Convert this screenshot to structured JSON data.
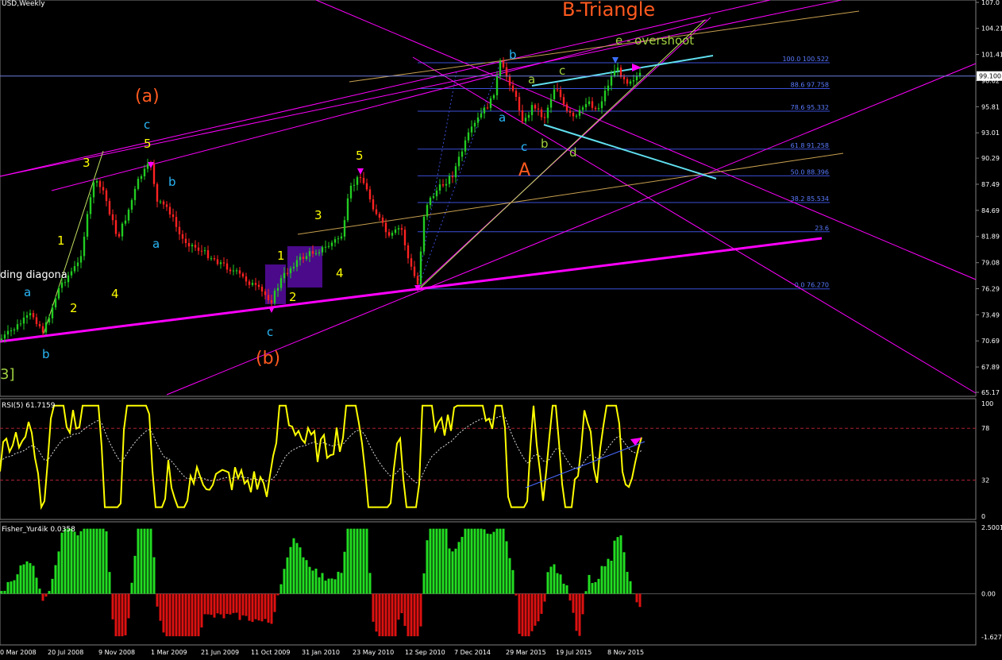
{
  "window": {
    "symbol_title": "USD,Weekly"
  },
  "colors": {
    "background": "#000000",
    "grid_border": "#7f7f7f",
    "bull_candle": "#22cc22",
    "bear_candle": "#ff2222",
    "magenta": "#ff00ff",
    "fib": "#3b4fd8",
    "fib_label": "#5a7bff",
    "orange": "#ff5a1f",
    "yellow": "#ffff00",
    "cyan": "#29b6f6",
    "olive": "#a0d040",
    "tan": "#c8a050",
    "rsi": "#ffff00",
    "fisher_pos": "#22dd22",
    "fisher_neg": "#dd1111",
    "light_cyan": "#60e0f0",
    "purple_box": "#4a0a8a"
  },
  "main_panel": {
    "price_axis_labels": [
      "107.0",
      "104.21",
      "101.41",
      "98.62",
      "95.81",
      "93.01",
      "90.29",
      "87.49",
      "84.69",
      "81.89",
      "79.08",
      "76.29",
      "73.49",
      "70.69",
      "67.89",
      "65.17"
    ],
    "current_price_label": "99.100",
    "fib_levels": [
      {
        "label": "100.0 100.522",
        "price": 100.52
      },
      {
        "label": "88.6 97.758",
        "price": 97.76
      },
      {
        "label": "78.6 95.332",
        "price": 95.33
      },
      {
        "label": "61.8 91.258",
        "price": 91.26
      },
      {
        "label": "50.0 88.396",
        "price": 88.4
      },
      {
        "label": "38.2 85.534",
        "price": 85.53
      },
      {
        "label": "23.6",
        "price": 82.4
      },
      {
        "label": "0.0 76.270",
        "price": 76.27
      }
    ],
    "annotations": [
      {
        "id": "title",
        "text": "B-Triangle",
        "color": "orange"
      },
      {
        "id": "overshoot",
        "text": "e - overshoot",
        "color": "olive"
      },
      {
        "id": "leading",
        "text": "ding diagona",
        "color": "white"
      },
      {
        "id": "bracket",
        "text": "3]",
        "color": "olive"
      },
      {
        "id": "w_a_big",
        "text": "(a)",
        "color": "orange"
      },
      {
        "id": "w_b_big",
        "text": "(b)",
        "color": "orange"
      },
      {
        "id": "w_A",
        "text": "A",
        "color": "orange"
      },
      {
        "id": "c1",
        "text": "c",
        "color": "cyan"
      },
      {
        "id": "y5a",
        "text": "5",
        "color": "yellow"
      },
      {
        "id": "y3a",
        "text": "3",
        "color": "yellow"
      },
      {
        "id": "y1a",
        "text": "1",
        "color": "yellow"
      },
      {
        "id": "y2a",
        "text": "2",
        "color": "yellow"
      },
      {
        "id": "y4a",
        "text": "4",
        "color": "yellow"
      },
      {
        "id": "ca",
        "text": "a",
        "color": "cyan"
      },
      {
        "id": "cb1",
        "text": "b",
        "color": "cyan"
      },
      {
        "id": "cb2",
        "text": "b",
        "color": "cyan"
      },
      {
        "id": "ca2",
        "text": "a",
        "color": "cyan"
      },
      {
        "id": "cc2",
        "text": "c",
        "color": "cyan"
      },
      {
        "id": "y1b",
        "text": "1",
        "color": "yellow"
      },
      {
        "id": "y2b",
        "text": "2",
        "color": "yellow"
      },
      {
        "id": "y3b",
        "text": "3",
        "color": "yellow"
      },
      {
        "id": "y4b",
        "text": "4",
        "color": "yellow"
      },
      {
        "id": "y5b",
        "text": "5",
        "color": "yellow"
      },
      {
        "id": "cb3",
        "text": "b",
        "color": "cyan"
      },
      {
        "id": "ca3",
        "text": "a",
        "color": "cyan"
      },
      {
        "id": "cc3",
        "text": "c",
        "color": "cyan"
      },
      {
        "id": "oa",
        "text": "a",
        "color": "olive"
      },
      {
        "id": "ob",
        "text": "b",
        "color": "olive"
      },
      {
        "id": "oc",
        "text": "c",
        "color": "olive"
      },
      {
        "id": "od",
        "text": "d",
        "color": "olive"
      }
    ]
  },
  "rsi_panel": {
    "title": "RSI(5) 61.7159",
    "axis_labels": [
      "100",
      "78",
      "32",
      "0"
    ],
    "levels": [
      78,
      32
    ]
  },
  "fisher_panel": {
    "title": "Fisher_Yur4ik 0.0358",
    "axis_labels": [
      "2.5001",
      "0.00",
      "-1.627"
    ]
  },
  "time_axis": {
    "labels": [
      "0 Mar 2008",
      "20 Jul 2008",
      "9 Nov 2008",
      "1 Mar 2009",
      "21 Jun 2009",
      "11 Oct 2009",
      "31 Jan 2010",
      "23 May 2010",
      "12 Sep 2010",
      "7 Dec 2014",
      "29 Mar 2015",
      "19 Jul 2015",
      "8 Nov 2015"
    ]
  },
  "chart_data": {
    "type": "candlestick",
    "title": "USD,Weekly",
    "ylim": [
      65.17,
      107.0
    ],
    "close_path": [
      {
        "x": "0 Mar 2008",
        "y": 72.5
      },
      {
        "x": "Jul 2008",
        "y": 72.0
      },
      {
        "x": "Nov 2008",
        "y": 87.5
      },
      {
        "x": "Nov 2008",
        "y": 82.5
      },
      {
        "x": "Mar 2009",
        "y": 89.5
      },
      {
        "x": "Jun 2009",
        "y": 80.0
      },
      {
        "x": "Oct 2009",
        "y": 75.0
      },
      {
        "x": "Jan 2010",
        "y": 80.5
      },
      {
        "x": "May 2010",
        "y": 88.3
      },
      {
        "x": "Sep 2010",
        "y": 76.3
      },
      {
        "x": "Dec 2014",
        "y": 90.0
      },
      {
        "x": "Mar 2015",
        "y": 100.5
      },
      {
        "x": "Mar 2015",
        "y": 93.5
      },
      {
        "x": "Jul 2015",
        "y": 97.5
      },
      {
        "x": "Nov 2015",
        "y": 100.5
      },
      {
        "x": "Nov 2015",
        "y": 99.1
      }
    ],
    "rsi": {
      "name": "RSI(5)",
      "last": 61.7159,
      "ylim": [
        0,
        100
      ],
      "levels": [
        78,
        32
      ]
    },
    "fisher": {
      "name": "Fisher_Yur4ik",
      "last": 0.0358,
      "ylim": [
        -1.627,
        2.5001
      ]
    }
  }
}
